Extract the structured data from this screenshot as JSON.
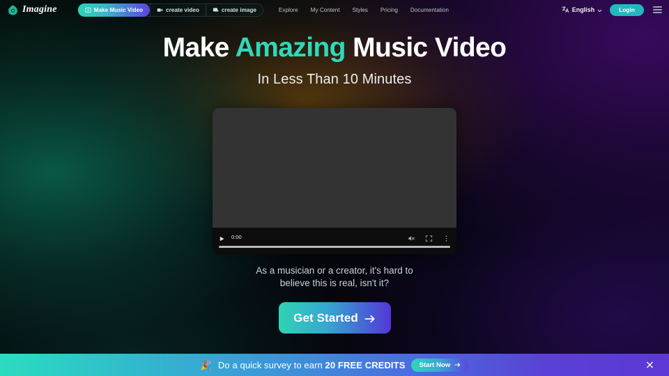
{
  "header": {
    "logo_icon": "imagine-leaf-logo-icon",
    "brand_name": "Imagine",
    "tabs": [
      {
        "label": "Make Music Video",
        "icon": "music-video-frame-icon",
        "active": true
      },
      {
        "label": "create video",
        "icon": "video-camera-icon",
        "active": false
      },
      {
        "label": "create image",
        "icon": "image-plus-icon",
        "active": false
      }
    ],
    "nav_links": [
      "Explore",
      "My Content",
      "Styles",
      "Pricing",
      "Documentation"
    ],
    "language": {
      "label": "English",
      "icon": "translate-icon",
      "chevron": "chevron-down-icon"
    },
    "login_label": "Login",
    "menu_icon": "hamburger-menu-icon"
  },
  "hero": {
    "headline_part1": "Make ",
    "headline_accent": "Amazing",
    "headline_part2": " Music Video",
    "subhead": "In Less Than 10 Minutes",
    "tagline_line1": "As a musician or a creator, it's hard to",
    "tagline_line2": "believe this is real, isn't it?",
    "cta_label": "Get Started",
    "cta_arrow_icon": "arrow-right-icon"
  },
  "video": {
    "play_icon": "play-icon",
    "current_time": "0:00",
    "mute_icon": "volume-muted-icon",
    "fullscreen_icon": "fullscreen-icon",
    "more_icon": "kebab-more-icon",
    "progress_percent": 0
  },
  "banner": {
    "emoji": "🎉",
    "text_before": "Do a quick survey to earn ",
    "text_bold": "20 FREE CREDITS",
    "button_label": "Start Now",
    "button_arrow_icon": "arrow-right-icon",
    "close_icon": "close-icon"
  },
  "colors": {
    "accent_teal": "#2fd9bb",
    "accent_purple": "#5337d8",
    "login_teal": "#22b8bf",
    "video_stage": "#333333",
    "banner_end_purple": "#5c38d4"
  }
}
